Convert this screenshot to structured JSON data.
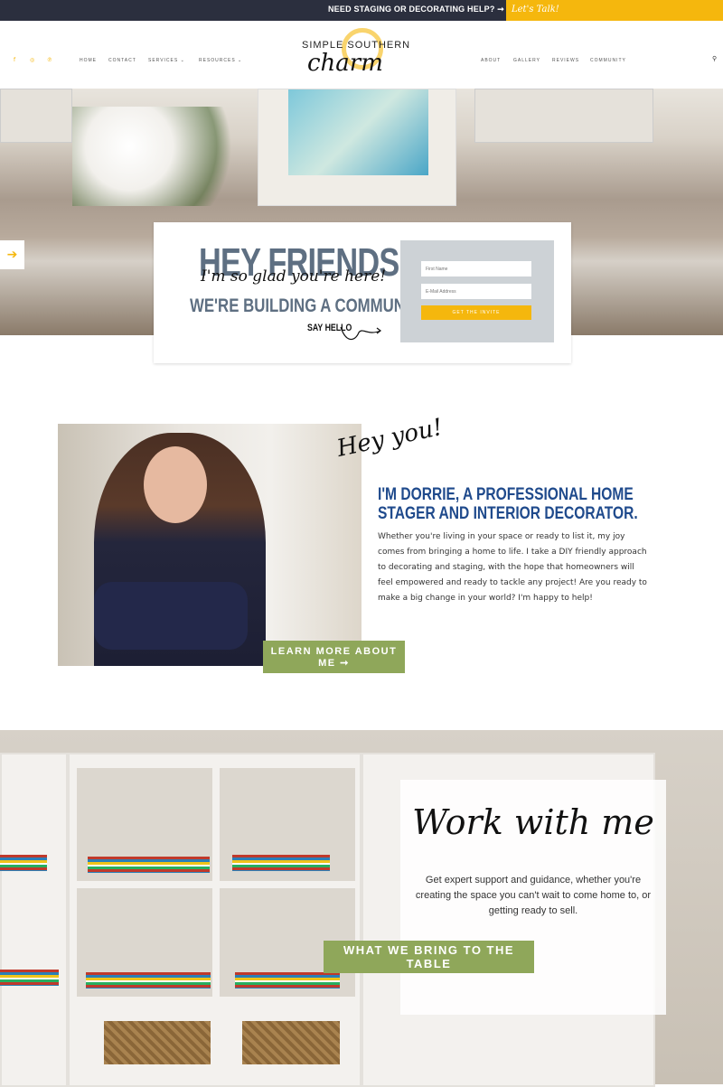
{
  "topbar": {
    "message": "NEED STAGING OR DECORATING HELP? ➞",
    "cta": "Let's Talk!"
  },
  "header": {
    "social": [
      {
        "icon": "facebook-icon",
        "glyph": "f"
      },
      {
        "icon": "instagram-icon",
        "glyph": "◎"
      },
      {
        "icon": "pinterest-icon",
        "glyph": "℗"
      }
    ],
    "nav_left": [
      "HOME",
      "CONTACT",
      "SERVICES ⌄",
      "RESOURCES ⌄"
    ],
    "nav_right": [
      "ABOUT",
      "GALLERY",
      "REVIEWS",
      "COMMUNITY"
    ],
    "logo": {
      "line1": "SIMPLE SOUTHERN",
      "line2": "charm"
    },
    "search_glyph": "⚲"
  },
  "hero": {
    "arrow": "➔",
    "slides": 4,
    "active_slide": 1,
    "card": {
      "title": "HEY FRIENDS",
      "script": "I'm so glad you're here!",
      "subtitle": "WE'RE BUILDING A COMMUNITY.",
      "say_hello": "SAY HELLO",
      "form": {
        "first_name_placeholder": "First Name",
        "email_placeholder": "E-Mail Address",
        "button": "GET THE INVITE"
      }
    }
  },
  "about": {
    "script": "Hey you!",
    "title": "I'M DORRIE, A PROFESSIONAL HOME STAGER AND INTERIOR DECORATOR.",
    "text": "Whether you're living in your space or ready to list it, my joy comes from bringing a home to life. I take a DIY friendly approach to decorating and staging, with the hope that homeowners will feel empowered and ready to tackle any project! Are you ready to make a big change in your world? I'm happy to help!",
    "button": "LEARN MORE ABOUT ME ➞"
  },
  "work": {
    "title": "Work with me",
    "text": "Get expert support and guidance, whether you're creating the space you can't wait to come home to, or getting ready to sell.",
    "button": "WHAT WE BRING TO THE TABLE"
  },
  "colors": {
    "accent": "#f5b70d",
    "navy": "#2b2f3e",
    "slate": "#5e6f82",
    "blue": "#1f4a8c",
    "green": "#8fa75a"
  }
}
